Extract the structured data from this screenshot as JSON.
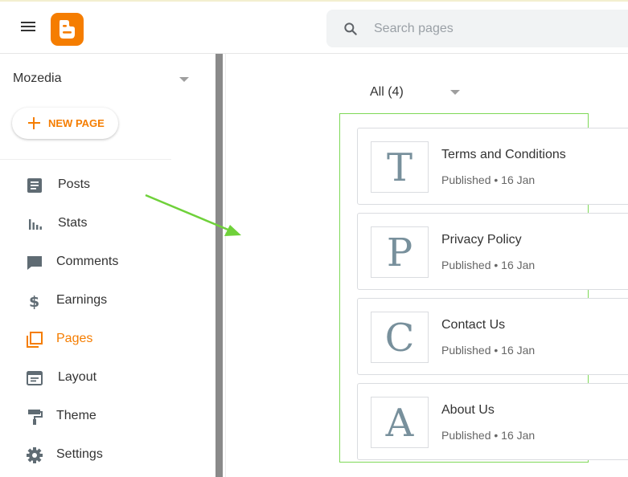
{
  "header": {
    "search_placeholder": "Search pages",
    "accent_color": "#f57d00"
  },
  "sidebar": {
    "blog_name": "Mozedia",
    "new_page_label": "NEW PAGE",
    "items": [
      {
        "label": "Posts",
        "icon": "posts-icon"
      },
      {
        "label": "Stats",
        "icon": "stats-icon"
      },
      {
        "label": "Comments",
        "icon": "comments-icon"
      },
      {
        "label": "Earnings",
        "icon": "dollar-icon"
      },
      {
        "label": "Pages",
        "icon": "pages-icon",
        "active": true
      },
      {
        "label": "Layout",
        "icon": "layout-icon"
      },
      {
        "label": "Theme",
        "icon": "paint-roller-icon"
      },
      {
        "label": "Settings",
        "icon": "gear-icon"
      }
    ]
  },
  "main": {
    "filter_label": "All (4)",
    "pages": [
      {
        "letter": "T",
        "title": "Terms and Conditions",
        "meta": "Published • 16 Jan"
      },
      {
        "letter": "P",
        "title": "Privacy Policy",
        "meta": "Published • 16 Jan"
      },
      {
        "letter": "C",
        "title": "Contact Us",
        "meta": "Published • 16 Jan"
      },
      {
        "letter": "A",
        "title": "About Us",
        "meta": "Published • 16 Jan"
      }
    ]
  }
}
